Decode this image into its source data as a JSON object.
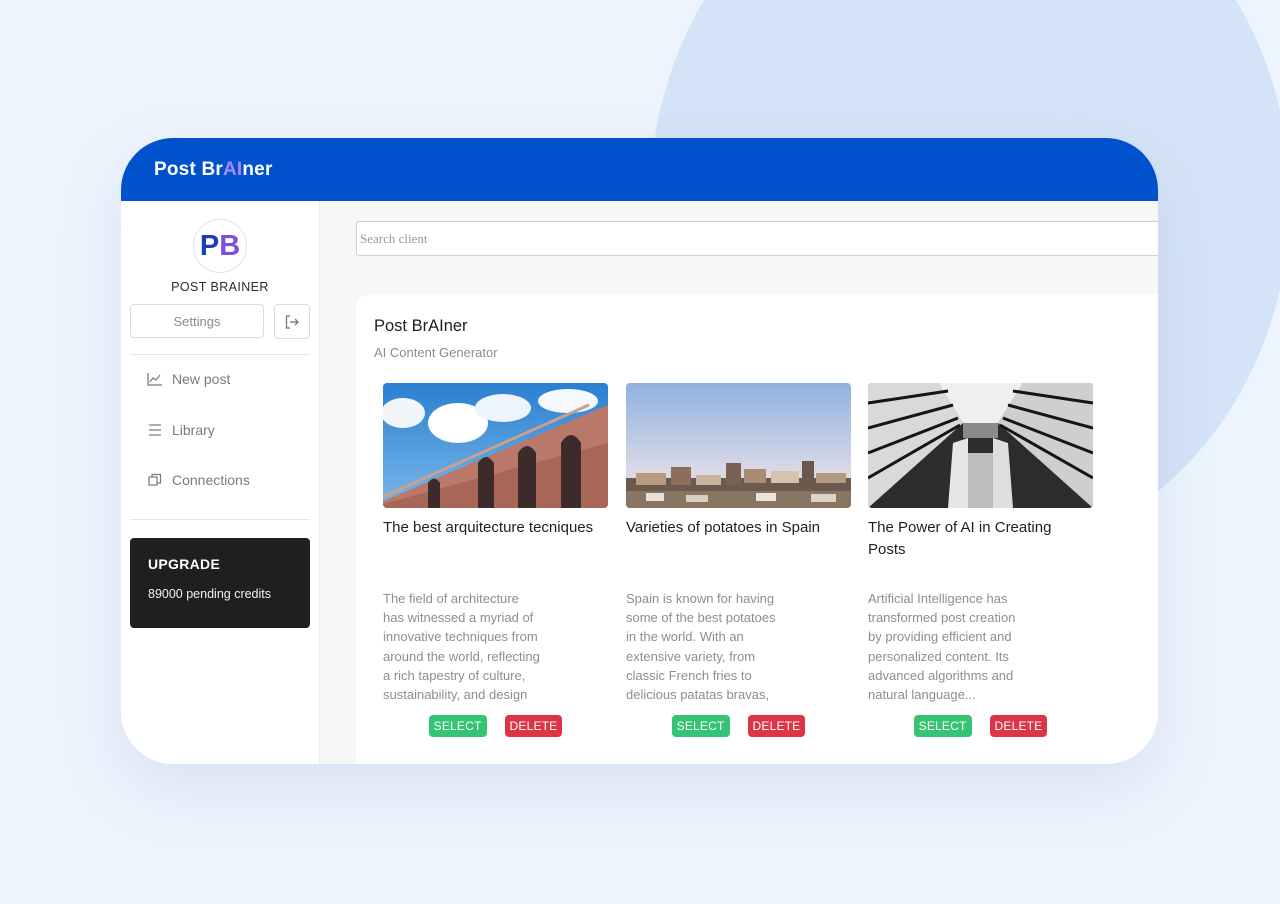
{
  "app": {
    "brand_prefix": "Post Br",
    "brand_ai": "AI",
    "brand_suffix": "ner"
  },
  "colors": {
    "header": "#0052cc",
    "accent": "#7c4fe0",
    "select": "#35c473",
    "delete": "#dc3545",
    "upgrade_bg": "#1f1f1f"
  },
  "sidebar": {
    "avatar_p": "P",
    "avatar_b": "B",
    "profile_name": "POST BRAINER",
    "settings_label": "Settings",
    "logout_icon": "logout-icon",
    "nav": [
      {
        "label": "New post",
        "icon": "chart-line-icon"
      },
      {
        "label": "Library",
        "icon": "menu-lines-icon"
      },
      {
        "label": "Connections",
        "icon": "copy-windows-icon"
      }
    ],
    "upgrade": {
      "title": "UPGRADE",
      "credits": "89000 pending credits"
    }
  },
  "search": {
    "placeholder": "Search client",
    "value": ""
  },
  "panel": {
    "title": "Post BrAIner",
    "subtitle": "AI Content Generator"
  },
  "cards": [
    {
      "title": "The best arquitecture tecniques",
      "description": "The field of architecture has witnessed a myriad of innovative techniques from around the world, reflecting a rich tapestry of culture, sustainability, and design excellence...",
      "image": "building-facade-image",
      "select_label": "SELECT",
      "delete_label": "DELETE"
    },
    {
      "title": "Varieties of potatoes in Spain",
      "description": "Spain is known for having some of the best potatoes in the world. With an extensive variety, from classic French fries to delicious patatas bravas, each region...",
      "image": "spanish-town-image",
      "select_label": "SELECT",
      "delete_label": "DELETE"
    },
    {
      "title": "The Power of AI in Creating Posts",
      "description": "Artificial Intelligence has transformed post creation by providing efficient and personalized content. Its advanced algorithms and natural language...",
      "image": "spiral-interior-image",
      "select_label": "SELECT",
      "delete_label": "DELETE"
    }
  ]
}
